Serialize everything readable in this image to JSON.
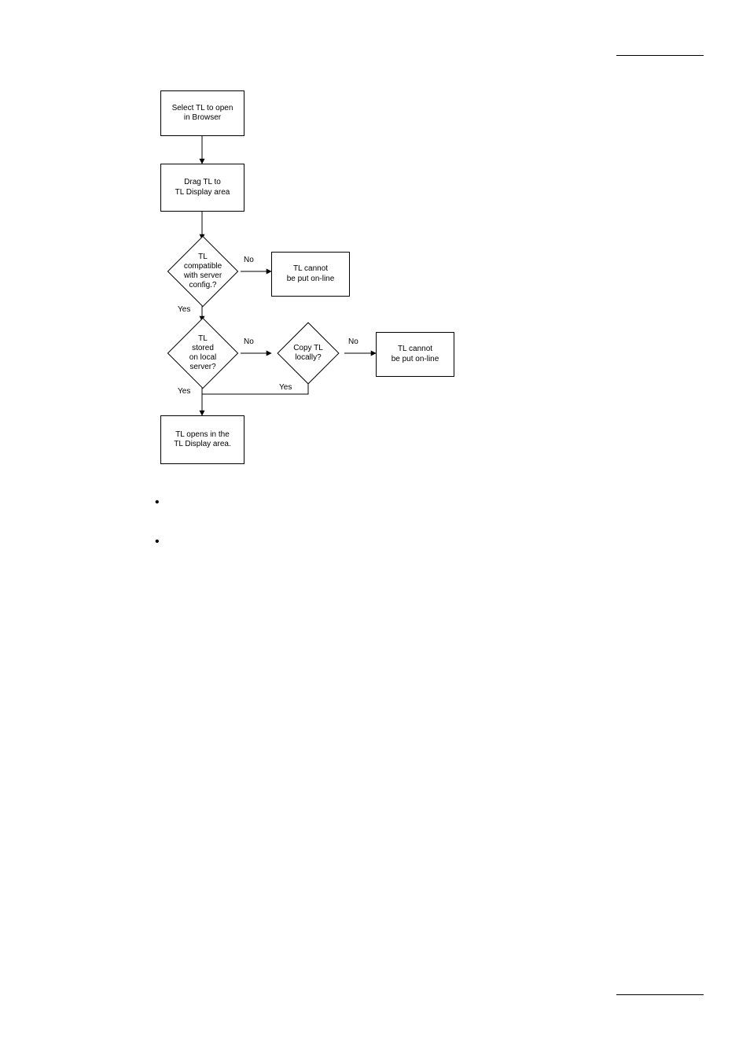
{
  "flow": {
    "box_select": "Select TL to open\nin Browser",
    "box_drag": "Drag TL to\nTL Display area",
    "dia_compat": "TL\ncompatible\nwith server\nconfig.?",
    "box_fail1": "TL cannot\nbe put on-line",
    "dia_stored": "TL\nstored\non local\nserver?",
    "dia_copy": "Copy TL\nlocally?",
    "box_fail2": "TL cannot\nbe put on-line",
    "box_open": "TL opens in the\nTL Display area.",
    "labels": {
      "compat_no": "No",
      "compat_yes": "Yes",
      "stored_no": "No",
      "stored_yes": "Yes",
      "copy_no": "No",
      "copy_yes": "Yes"
    }
  },
  "bullets": [
    "•",
    "•"
  ]
}
